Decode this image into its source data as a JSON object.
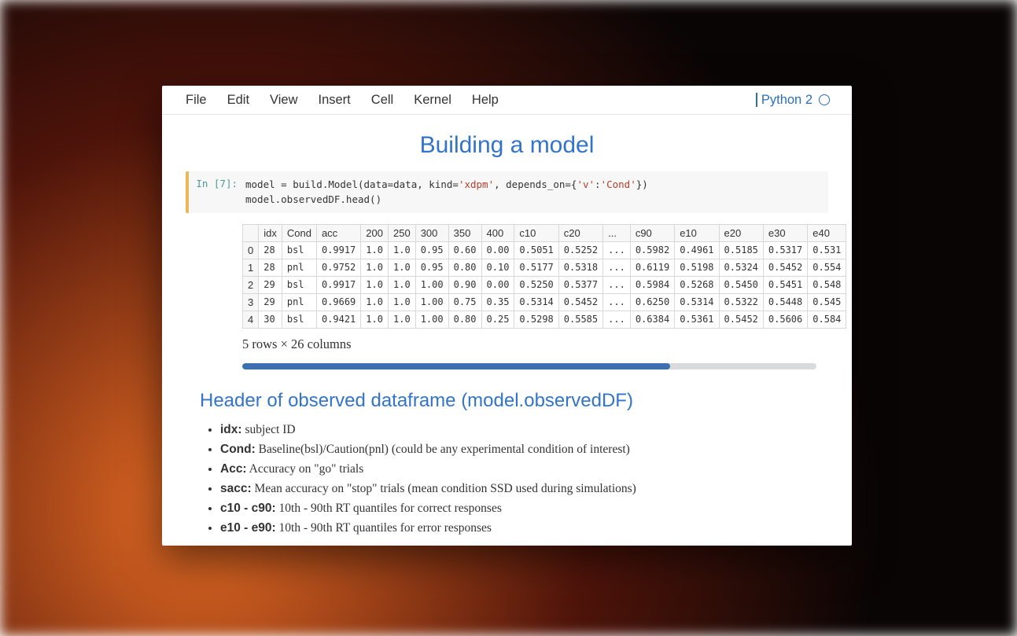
{
  "menu": {
    "items": [
      "File",
      "Edit",
      "View",
      "Insert",
      "Cell",
      "Kernel",
      "Help"
    ],
    "kernel": "Python 2"
  },
  "title": "Building a model",
  "cell": {
    "prompt": "In [7]:",
    "line1_pre": "model = build.Model(data=data, kind=",
    "line1_s1": "'xdpm'",
    "line1_mid": ", depends_on={",
    "line1_s2": "'v'",
    "line1_sep": ":",
    "line1_s3": "'Cond'",
    "line1_post": "})",
    "line2": "model.observedDF.head()"
  },
  "table": {
    "headers": [
      "",
      "idx",
      "Cond",
      "acc",
      "200",
      "250",
      "300",
      "350",
      "400",
      "c10",
      "c20",
      "...",
      "c90",
      "e10",
      "e20",
      "e30",
      "e40"
    ],
    "rows": [
      {
        "ix": "0",
        "cells": [
          "28",
          "bsl",
          "0.9917",
          "1.0",
          "1.0",
          "0.95",
          "0.60",
          "0.00",
          "0.5051",
          "0.5252",
          "...",
          "0.5982",
          "0.4961",
          "0.5185",
          "0.5317",
          "0.531"
        ]
      },
      {
        "ix": "1",
        "cells": [
          "28",
          "pnl",
          "0.9752",
          "1.0",
          "1.0",
          "0.95",
          "0.80",
          "0.10",
          "0.5177",
          "0.5318",
          "...",
          "0.6119",
          "0.5198",
          "0.5324",
          "0.5452",
          "0.554"
        ]
      },
      {
        "ix": "2",
        "cells": [
          "29",
          "bsl",
          "0.9917",
          "1.0",
          "1.0",
          "1.00",
          "0.90",
          "0.00",
          "0.5250",
          "0.5377",
          "...",
          "0.5984",
          "0.5268",
          "0.5450",
          "0.5451",
          "0.548"
        ]
      },
      {
        "ix": "3",
        "cells": [
          "29",
          "pnl",
          "0.9669",
          "1.0",
          "1.0",
          "1.00",
          "0.75",
          "0.35",
          "0.5314",
          "0.5452",
          "...",
          "0.6250",
          "0.5314",
          "0.5322",
          "0.5448",
          "0.545"
        ]
      },
      {
        "ix": "4",
        "cells": [
          "30",
          "bsl",
          "0.9421",
          "1.0",
          "1.0",
          "1.00",
          "0.80",
          "0.25",
          "0.5298",
          "0.5585",
          "...",
          "0.6384",
          "0.5361",
          "0.5452",
          "0.5606",
          "0.584"
        ]
      }
    ],
    "shape": "5 rows × 26 columns"
  },
  "scroll": {
    "ratio": 0.745
  },
  "subhead": "Header of observed dataframe (model.observedDF)",
  "desc": [
    {
      "term": "idx:",
      "text": " subject ID"
    },
    {
      "term": "Cond:",
      "text": " Baseline(bsl)/Caution(pnl) (could be any experimental condition of interest)"
    },
    {
      "term": "Acc:",
      "text": " Accuracy on \"go\" trials"
    },
    {
      "term": "sacc:",
      "text": " Mean accuracy on \"stop\" trials (mean condition SSD used during simulations)"
    },
    {
      "term": "c10 - c90:",
      "text": " 10th - 90th RT quantiles for correct responses"
    },
    {
      "term": "e10 - e90:",
      "text": " 10th - 90th RT quantiles for error responses"
    }
  ]
}
